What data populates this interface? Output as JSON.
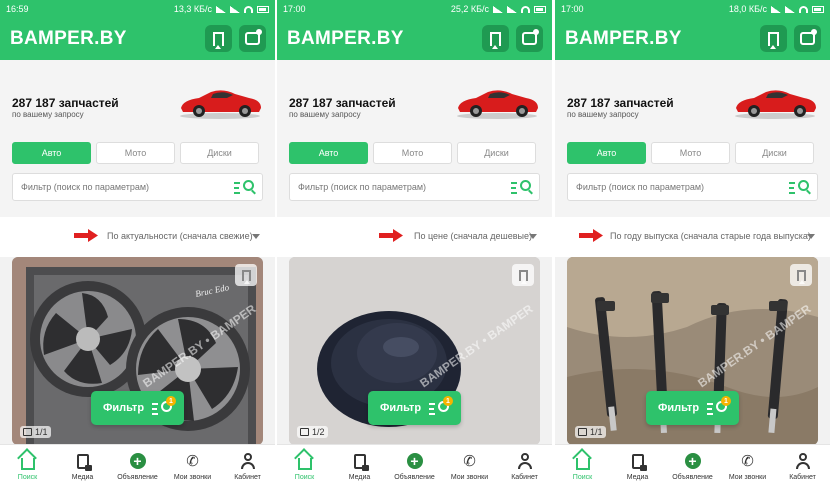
{
  "app": {
    "logo": "BAMPER.BY",
    "count": "287 187 запчастей",
    "count_sub": "по вашему запросу",
    "tabs": [
      "Авто",
      "Мото",
      "Диски"
    ],
    "search_placeholder": "Фильтр (поиск по параметрам)",
    "fab_label": "Фильтр",
    "fab_badge": "1",
    "watermark": "BAMPER.BY • BAMPER",
    "colors": {
      "brand": "#2ec26b",
      "brand_dark": "#1f9a52",
      "arrow": "#e02020"
    },
    "nav": [
      {
        "label": "Поиск",
        "icon": "home-icon",
        "active": true
      },
      {
        "label": "Медиа",
        "icon": "media-icon",
        "active": false
      },
      {
        "label": "Объявление",
        "icon": "plus-icon",
        "active": false
      },
      {
        "label": "Мои звонки",
        "icon": "phone-icon",
        "active": false
      },
      {
        "label": "Кабинет",
        "icon": "user-icon",
        "active": false
      }
    ]
  },
  "screens": [
    {
      "status": {
        "time": "16:59",
        "net": "13,3 КБ/с",
        "battery_icon": "battery-icon"
      },
      "sort_label": "По актуальности (сначала свежие)",
      "photo_counter": "1/1",
      "photo": "radiator-fan"
    },
    {
      "status": {
        "time": "17:00",
        "net": "25,2 КБ/с",
        "battery_icon": "battery-icon"
      },
      "sort_label": "По цене (сначала дешевые)",
      "photo_counter": "1/2",
      "photo": "rubber-plug"
    },
    {
      "status": {
        "time": "17:00",
        "net": "18,0 КБ/с",
        "battery_icon": "battery-icon"
      },
      "sort_label": "По году выпуска (сначала старые года выпуска)",
      "photo_counter": "1/1",
      "photo": "fuel-injectors"
    }
  ]
}
